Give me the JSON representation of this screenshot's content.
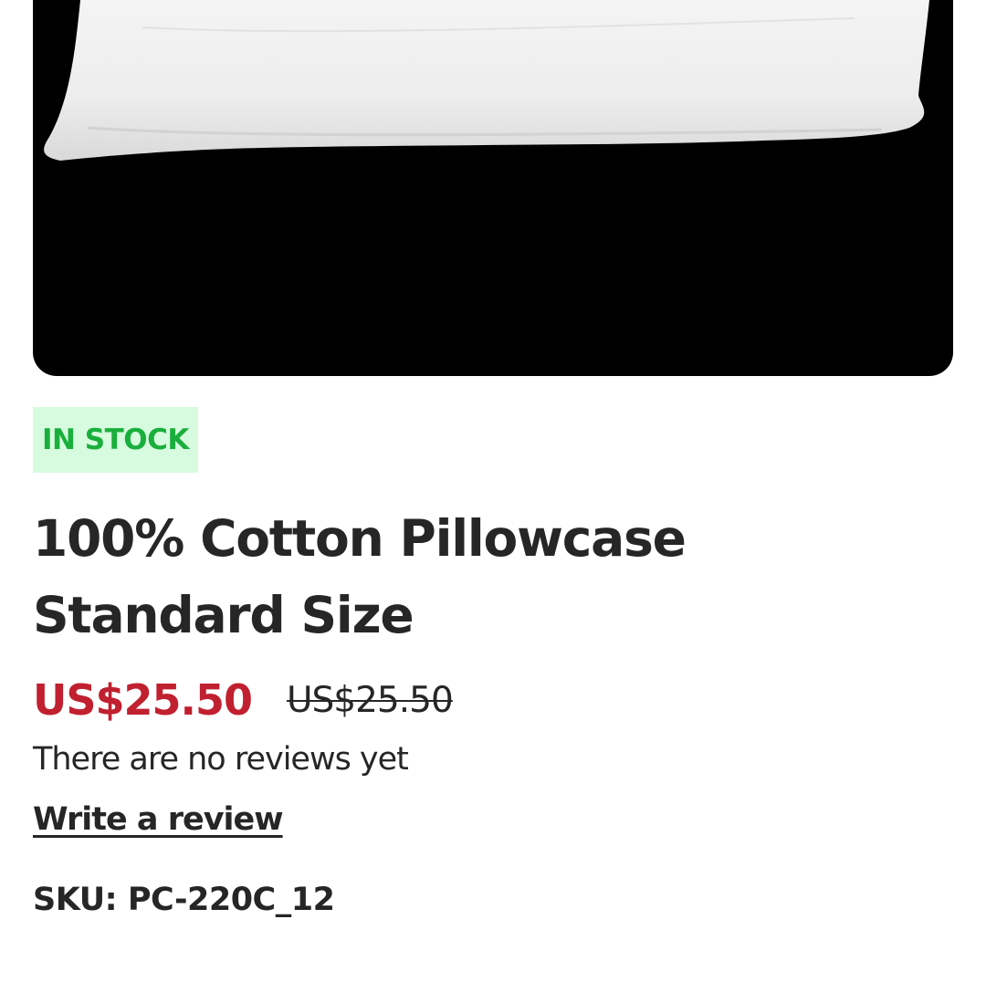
{
  "product": {
    "stock_status": "IN STOCK",
    "title": "100% Cotton Pillowcase Standard Size",
    "price_current": "US$25.50",
    "price_original": "US$25.50",
    "reviews_text": "There are no reviews yet",
    "write_review_label": "Write a review",
    "sku_label": "SKU:",
    "sku_value": "PC-220C_12"
  },
  "colors": {
    "price_red": "#c0202f",
    "stock_green": "#1aaf3c",
    "stock_bg": "#d7fbdf",
    "text_dark": "#262626",
    "image_bg": "#000000"
  }
}
